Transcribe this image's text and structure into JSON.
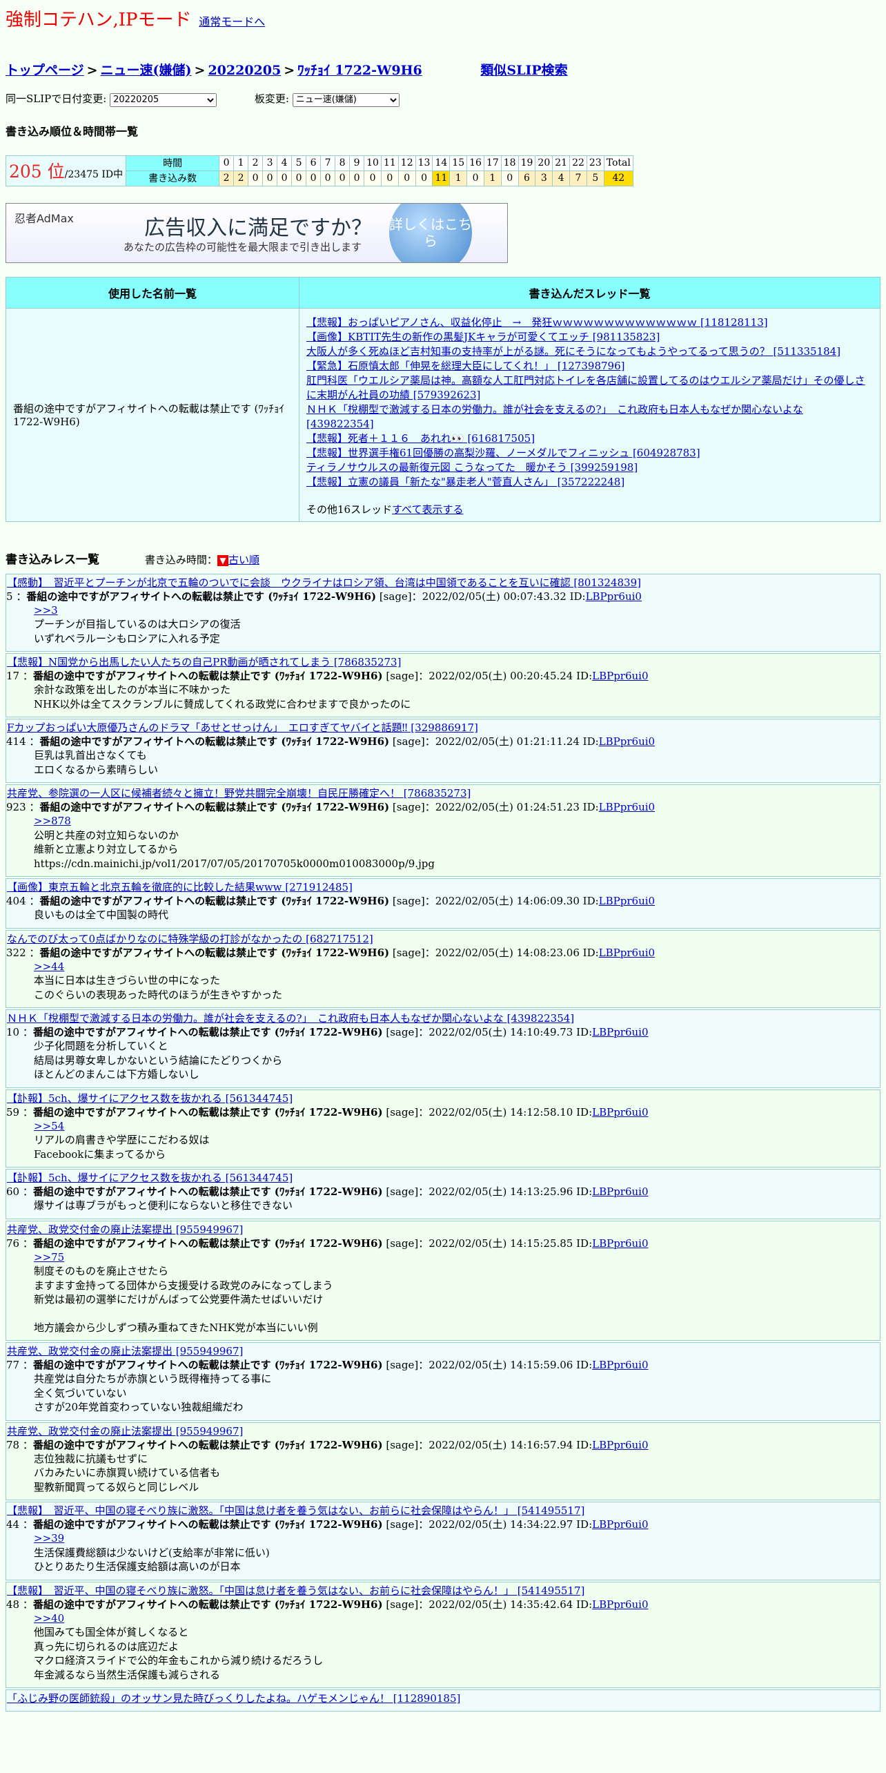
{
  "header": {
    "mode_title": "強制コテハン,IPモード",
    "mode_link": "通常モードへ"
  },
  "breadcrumb": {
    "top": "トップページ",
    "board": "ニュー速(嫌儲)",
    "date": "20220205",
    "slip": "ﾜｯﾁｮｲ 1722-W9H6",
    "similar": "類似SLIP検索"
  },
  "selects": {
    "date_label": "同一SLIPで日付変更:",
    "date_value": "20220205",
    "board_label": "板変更:",
    "board_value": "ニュー速(嫌儲)"
  },
  "ranking": {
    "section_title": "書き込み順位＆時間帯一覧",
    "rank": "205 位",
    "total_ids": "/23475 ID中",
    "time_label": "時間",
    "count_label": "書き込み数",
    "hours": [
      "0",
      "1",
      "2",
      "3",
      "4",
      "5",
      "6",
      "7",
      "8",
      "9",
      "10",
      "11",
      "12",
      "13",
      "14",
      "15",
      "16",
      "17",
      "18",
      "19",
      "20",
      "21",
      "22",
      "23",
      "Total"
    ],
    "counts": [
      "2",
      "2",
      "0",
      "0",
      "0",
      "0",
      "0",
      "0",
      "0",
      "0",
      "0",
      "0",
      "0",
      "0",
      "11",
      "1",
      "0",
      "1",
      "0",
      "6",
      "3",
      "4",
      "7",
      "5",
      "42"
    ]
  },
  "ad": {
    "logo": "忍者AdMax",
    "main": "広告収入に満足ですか？",
    "sub": "あなたの広告枠の可能性を最大限まで引き出します",
    "button": "詳しくはこちら"
  },
  "names": {
    "col_names": "使用した名前一覧",
    "col_threads": "書き込んだスレッド一覧",
    "name": "番組の途中ですがアフィサイトへの転載は禁止です (ﾜｯﾁｮｲ 1722-W9H6)",
    "threads": [
      "【悲報】おっぱいピアノさん、収益化停止　→　発狂ｗｗｗｗｗｗｗｗｗｗｗｗｗｗ [118128113]",
      "【画像】KBTIT先生の新作の黒髪JKキャラが可愛くてエッチ [981135823]",
      "大阪人が多く死ぬほど吉村知事の支持率が上がる謎。死にそうになってもようやってるって思うの？ [511335184]",
      "【緊急】石原慎太郎「伸晃を総理大臣にしてくれ！」 [127398796]",
      "肛門科医「ウエルシア薬局は神。高額な人工肛門対応トイレを各店舗に設置してるのはウエルシア薬局だけ」その優しさに末期がん社員の功績 [579392623]",
      "ＮＨＫ「梲棚型で激減する日本の労働力。誰が社会を支えるの?」　これ政府も日本人もなぜか関心ないよな [439822354]",
      "【悲報】死者＋１１６　あれれ👀 [616817505]",
      "【悲報】世界選手権61回優勝の高梨沙羅、ノーメダルでフィニッシュ [604928783]",
      "ティラノサウルスの最新復元図 こうなってた　暖かそう [399259198]",
      "【悲報】立憲の議員「新たな\"暴走老人\"菅直人さん」 [357222248]"
    ],
    "more_prefix": "その他16スレッド",
    "more_link": "すべて表示する"
  },
  "res": {
    "title": "書き込みレス一覧",
    "time_label": "書き込み時間：",
    "sort_icon": "▼",
    "order_link": "古い順"
  },
  "posts": [
    {
      "thread": "【感動】　習近平とプーチンが北京で五輪のついでに会談　ウクライナはロシア領、台湾は中国領であることを互いに確認 [801324839]",
      "num": "5",
      "name": "番組の途中ですがアフィサイトへの転載は禁止です (ﾜｯﾁｮｲ 1722-W9H6)",
      "meta": "[sage]：2022/02/05(土) 00:07:43.32 ID:",
      "id": "LBPpr6ui0",
      "anchor": ">>3",
      "lines": [
        "プーチンが目指しているのは大ロシアの復活",
        "いずれベラルーシもロシアに入れる予定"
      ]
    },
    {
      "thread": "【悲報】N国党から出馬したい人たちの自己PR動画が晒されてしまう [786835273]",
      "num": "17",
      "name": "番組の途中ですがアフィサイトへの転載は禁止です (ﾜｯﾁｮｲ 1722-W9H6)",
      "meta": "[sage]：2022/02/05(土) 00:20:45.24 ID:",
      "id": "LBPpr6ui0",
      "anchor": "",
      "lines": [
        "余計な政策を出したのが本当に不味かった",
        "NHK以外は全てスクランブルに賛成してくれる政党に合わせますで良かったのに"
      ]
    },
    {
      "thread": "Fカップおっぱい大原優乃さんのドラマ「あせとせっけん」　エロすぎてヤバイと話題‼ [329886917]",
      "num": "414",
      "name": "番組の途中ですがアフィサイトへの転載は禁止です (ﾜｯﾁｮｲ 1722-W9H6)",
      "meta": "[sage]：2022/02/05(土) 01:21:11.24 ID:",
      "id": "LBPpr6ui0",
      "anchor": "",
      "lines": [
        "巨乳は乳首出さなくても",
        "エロくなるから素晴らしい"
      ]
    },
    {
      "thread": "共産党、参院選の一人区に候補者続々と擁立！野党共闘完全崩壊！自民圧勝確定へ！ [786835273]",
      "num": "923",
      "name": "番組の途中ですがアフィサイトへの転載は禁止です (ﾜｯﾁｮｲ 1722-W9H6)",
      "meta": "[sage]：2022/02/05(土) 01:24:51.23 ID:",
      "id": "LBPpr6ui0",
      "anchor": ">>878",
      "lines": [
        "公明と共産の対立知らないのか",
        "維新と立憲より対立してるから",
        "https://cdn.mainichi.jp/vol1/2017/07/05/20170705k0000m010083000p/9.jpg"
      ]
    },
    {
      "thread": "【画像】東京五輪と北京五輪を徹底的に比較した結果www [271912485]",
      "num": "404",
      "name": "番組の途中ですがアフィサイトへの転載は禁止です (ﾜｯﾁｮｲ 1722-W9H6)",
      "meta": "[sage]：2022/02/05(土) 14:06:09.30 ID:",
      "id": "LBPpr6ui0",
      "anchor": "",
      "lines": [
        "良いものは全て中国製の時代"
      ]
    },
    {
      "thread": "なんでのび太って0点ばかりなのに特殊学級の打診がなかったの [682717512]",
      "num": "322",
      "name": "番組の途中ですがアフィサイトへの転載は禁止です (ﾜｯﾁｮｲ 1722-W9H6)",
      "meta": "[sage]：2022/02/05(土) 14:08:23.06 ID:",
      "id": "LBPpr6ui0",
      "anchor": ">>44",
      "lines": [
        "本当に日本は生きづらい世の中になった",
        "このぐらいの表現あった時代のほうが生きやすかった"
      ]
    },
    {
      "thread": "ＮＨＫ「梲棚型で激減する日本の労働力。誰が社会を支えるの?」　これ政府も日本人もなぜか関心ないよな [439822354]",
      "num": "10",
      "name": "番組の途中ですがアフィサイトへの転載は禁止です (ﾜｯﾁｮｲ 1722-W9H6)",
      "meta": "[sage]：2022/02/05(土) 14:10:49.73 ID:",
      "id": "LBPpr6ui0",
      "anchor": "",
      "lines": [
        "少子化問題を分析していくと",
        "結局は男尊女卑しかないという結論にたどりつくから",
        "ほとんどのまんこは下方婚しないし"
      ]
    },
    {
      "thread": "【訃報】5ch、爆サイにアクセス数を抜かれる [561344745]",
      "num": "59",
      "name": "番組の途中ですがアフィサイトへの転載は禁止です (ﾜｯﾁｮｲ 1722-W9H6)",
      "meta": "[sage]：2022/02/05(土) 14:12:58.10 ID:",
      "id": "LBPpr6ui0",
      "anchor": ">>54",
      "lines": [
        "リアルの肩書きや学歴にこだわる奴は",
        "Facebookに集まってるから"
      ]
    },
    {
      "thread": "【訃報】5ch、爆サイにアクセス数を抜かれる [561344745]",
      "num": "60",
      "name": "番組の途中ですがアフィサイトへの転載は禁止です (ﾜｯﾁｮｲ 1722-W9H6)",
      "meta": "[sage]：2022/02/05(土) 14:13:25.96 ID:",
      "id": "LBPpr6ui0",
      "anchor": "",
      "lines": [
        "爆サイは専ブラがもっと便利にならないと移住できない"
      ]
    },
    {
      "thread": "共産党、政党交付金の廃止法案提出 [955949967]",
      "num": "76",
      "name": "番組の途中ですがアフィサイトへの転載は禁止です (ﾜｯﾁｮｲ 1722-W9H6)",
      "meta": "[sage]：2022/02/05(土) 14:15:25.85 ID:",
      "id": "LBPpr6ui0",
      "anchor": ">>75",
      "lines": [
        "制度そのものを廃止させたら",
        "ますます金持ってる団体から支援受ける政党のみになってしまう",
        "新党は最初の選挙にだけがんばって公党要件満たせばいいだけ",
        "",
        "地方議会から少しずつ積み重ねてきたNHK党が本当にいい例"
      ]
    },
    {
      "thread": "共産党、政党交付金の廃止法案提出 [955949967]",
      "num": "77",
      "name": "番組の途中ですがアフィサイトへの転載は禁止です (ﾜｯﾁｮｲ 1722-W9H6)",
      "meta": "[sage]：2022/02/05(土) 14:15:59.06 ID:",
      "id": "LBPpr6ui0",
      "anchor": "",
      "lines": [
        "共産党は自分たちが赤旗という既得権持ってる事に",
        "全く気づいていない",
        "さすが20年党首変わっていない独裁組織だわ"
      ]
    },
    {
      "thread": "共産党、政党交付金の廃止法案提出 [955949967]",
      "num": "78",
      "name": "番組の途中ですがアフィサイトへの転載は禁止です (ﾜｯﾁｮｲ 1722-W9H6)",
      "meta": "[sage]：2022/02/05(土) 14:16:57.94 ID:",
      "id": "LBPpr6ui0",
      "anchor": "",
      "lines": [
        "志位独裁に抗議もせずに",
        "バカみたいに赤旗買い続けている信者も",
        "聖教新聞買ってる奴らと同じレベル"
      ]
    },
    {
      "thread": "【悲報】　習近平、中国の寝そべり族に激怒。「中国は怠け者を養う気はない、お前らに社会保障はやらん！」 [541495517]",
      "num": "44",
      "name": "番組の途中ですがアフィサイトへの転載は禁止です (ﾜｯﾁｮｲ 1722-W9H6)",
      "meta": "[sage]：2022/02/05(土) 14:34:22.97 ID:",
      "id": "LBPpr6ui0",
      "anchor": ">>39",
      "lines": [
        "生活保護費総額は少ないけど(支給率が非常に低い)",
        "ひとりあたり生活保護支給額は高いのが日本"
      ]
    },
    {
      "thread": "【悲報】　習近平、中国の寝そべり族に激怒。「中国は怠け者を養う気はない、お前らに社会保障はやらん！」 [541495517]",
      "num": "48",
      "name": "番組の途中ですがアフィサイトへの転載は禁止です (ﾜｯﾁｮｲ 1722-W9H6)",
      "meta": "[sage]：2022/02/05(土) 14:35:42.64 ID:",
      "id": "LBPpr6ui0",
      "anchor": ">>40",
      "lines": [
        "他国みても国全体が貧しくなると",
        "真っ先に切られるのは底辺だよ",
        "マクロ経済スライドで公的年金もこれから減り続けるだろうし",
        "年金減るなら当然生活保護も減らされる"
      ]
    },
    {
      "thread": "「ふじみ野の医師銃殺」のオッサン見た時びっくりしたよね。ハゲモメンじゃん！ [112890185]",
      "num": "",
      "name": "",
      "meta": "",
      "id": "",
      "anchor": "",
      "lines": []
    }
  ]
}
